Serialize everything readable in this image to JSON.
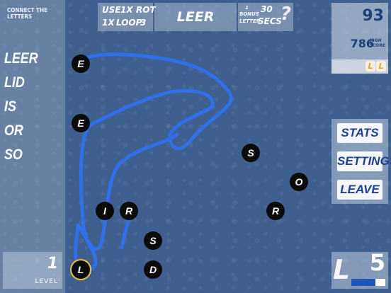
{
  "left": {
    "title": "CONNECT THE LETTERS",
    "words": [
      "LEER",
      "LID",
      "IS",
      "OR",
      "SO"
    ],
    "level_value": "1",
    "level_label": "LEVEL"
  },
  "top": {
    "use": "USE",
    "use_count": "1X",
    "rot": "ROT",
    "loop_count": "1X",
    "loop": "LOOP",
    "loop_value": "3",
    "current_word": "LEER",
    "bonus_num": "1",
    "bonus": "BONUS",
    "letter": "LETTER",
    "secs_num": "30",
    "secs": "SECS",
    "help": "?"
  },
  "right": {
    "score": "93",
    "high_score": "786",
    "high_label_1": "HIGH",
    "high_label_2": "SCORE",
    "menu": [
      "STATS",
      "SETTINGS",
      "LEAVE"
    ],
    "lives": "5",
    "lives_fraction": 0.7,
    "logo_glyph": "L"
  },
  "board": {
    "letters": [
      {
        "char": "E"
      },
      {
        "char": "E"
      },
      {
        "char": "S"
      },
      {
        "char": "O"
      },
      {
        "char": "I"
      },
      {
        "char": "R"
      },
      {
        "char": "R"
      },
      {
        "char": "S"
      },
      {
        "char": "L",
        "selected": true
      },
      {
        "char": "D"
      }
    ],
    "path_color": "#2f6fe8"
  }
}
